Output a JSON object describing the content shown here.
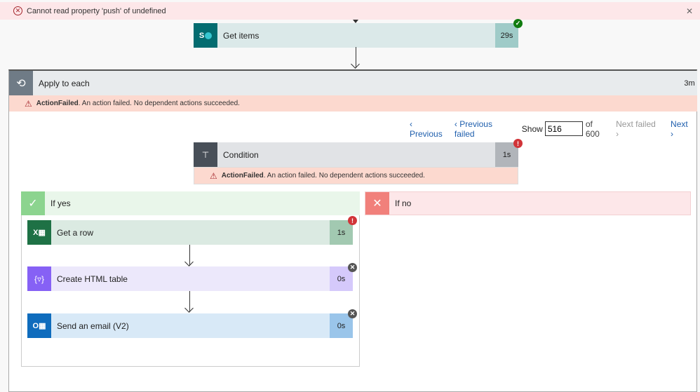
{
  "error_banner": {
    "message": "Cannot read property 'push' of undefined",
    "icon": "circle-x-icon",
    "close_icon": "close-icon"
  },
  "get_items": {
    "title": "Get items",
    "duration": "29s",
    "status": "succeeded",
    "icon": "sharepoint-icon"
  },
  "apply_to_each": {
    "title": "Apply to each",
    "duration": "3m",
    "icon": "loop-icon",
    "error": {
      "code": "ActionFailed",
      "message": ". An action failed. No dependent actions succeeded."
    }
  },
  "pager": {
    "previous": "Previous",
    "previous_failed": "Previous failed",
    "show_label": "Show",
    "current": "516",
    "of_label": "of 600",
    "next_failed": "Next failed",
    "next": "Next"
  },
  "condition": {
    "title": "Condition",
    "duration": "1s",
    "status": "failed",
    "icon": "condition-icon",
    "error": {
      "code": "ActionFailed",
      "message": ". An action failed. No dependent actions succeeded."
    }
  },
  "if_yes": {
    "title": "If yes",
    "actions": [
      {
        "title": "Get a row",
        "duration": "1s",
        "status": "failed",
        "icon": "excel-icon"
      },
      {
        "title": "Create HTML table",
        "duration": "0s",
        "status": "skipped",
        "icon": "data-operation-icon"
      },
      {
        "title": "Send an email (V2)",
        "duration": "0s",
        "status": "skipped",
        "icon": "outlook-icon"
      }
    ]
  },
  "if_no": {
    "title": "If no"
  },
  "colors": {
    "error_red": "#d13438",
    "success_green": "#107c10",
    "link_blue": "#1f5fad"
  }
}
